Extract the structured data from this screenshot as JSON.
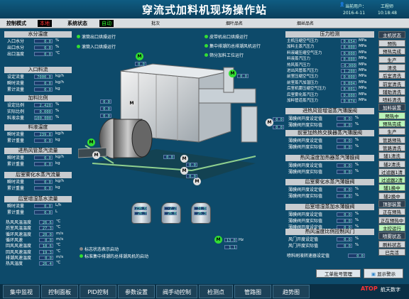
{
  "header": {
    "title": "穿流式加料机现场操作站",
    "user_label": "当前用户：",
    "user_value": "工程师",
    "date": "2016-4-11",
    "time": "10:18:48"
  },
  "statusbar": {
    "mode_label": "控制模式",
    "mode_value": "本地",
    "status_label": "系统状态",
    "status_value": "自动",
    "field1": "批次",
    "field2": "烟叶品名",
    "field3": "烟丝品名"
  },
  "left": {
    "water_title": "水分温度",
    "water_rows": [
      {
        "label": "入口水分",
        "value": "0.0",
        "unit": "%"
      },
      {
        "label": "出口水分",
        "value": "0.0",
        "unit": "%"
      },
      {
        "label": "出口温度",
        "value": "0.0",
        "unit": "℃"
      }
    ],
    "flow_title": "入口料流",
    "flow_rows": [
      {
        "label": "设定流量",
        "value": "7000.0",
        "unit": "kg/h"
      },
      {
        "label": "瞬时流量",
        "value": "0.0",
        "unit": "kg/h"
      },
      {
        "label": "累计流量",
        "value": "0.0",
        "unit": "kg"
      }
    ],
    "ratio_title": "加料比例",
    "ratio_rows": [
      {
        "label": "设定比例",
        "value": "2.420",
        "unit": "%"
      },
      {
        "label": "实际比例",
        "value": "0.000",
        "unit": "%"
      },
      {
        "label": "料液余量",
        "value": "100.000",
        "unit": "%"
      }
    ],
    "feedtemp_title": "料液温度",
    "feedtemp_rows": [
      {
        "label": "瞬时流量",
        "value": "239.8",
        "unit": "kg/h"
      },
      {
        "label": "累计重量",
        "value": "0.0",
        "unit": "kg"
      }
    ],
    "inlet_title": "进热风管蒸汽流量",
    "inlet_rows": [
      {
        "label": "瞬时流量",
        "value": "0.0",
        "unit": "kg/h"
      },
      {
        "label": "累计重量",
        "value": "0.0",
        "unit": "kg"
      }
    ],
    "spray_title": "后室雾化水蒸汽流量",
    "spray_rows": [
      {
        "label": "瞬时流量",
        "value": "0.0",
        "unit": "kg/h"
      },
      {
        "label": "累计重量",
        "value": "0.0",
        "unit": "kg"
      }
    ],
    "addwater_title": "后室增湿蒸水流量",
    "addwater_rows": [
      {
        "label": "瞬时流量",
        "value": "0.0",
        "unit": "L/h"
      },
      {
        "label": "累计重量",
        "value": "0.0",
        "unit": "L"
      }
    ],
    "misc_rows": [
      {
        "label": "热风风温温度",
        "value": "26.6",
        "unit": "℃"
      },
      {
        "label": "后室风温温度",
        "value": "27.3",
        "unit": "℃"
      },
      {
        "label": "循环风速温度",
        "value": "20.0",
        "unit": "m/s"
      },
      {
        "label": "循环风速",
        "value": "0.0",
        "unit": "m/s"
      },
      {
        "label": "回风风速温度",
        "value": "18.6",
        "unit": "℃"
      },
      {
        "label": "回风风速温度",
        "value": "19.3",
        "unit": "℃"
      },
      {
        "label": "排潮风速温度",
        "value": "0.0",
        "unit": "m/s"
      },
      {
        "label": "热风温度",
        "value": "26.4",
        "unit": "℃"
      }
    ]
  },
  "legend": {
    "top": [
      "滚筒出口烘燥运行",
      "滚筒入口烘燥运行"
    ],
    "top2": [
      "皮带机出口烘燥运行",
      "集中排潮的总排潮风机运行",
      "筛分加料工位运行"
    ],
    "bottom": [
      "标志状态表示启动",
      "标准集中排潮的总排潮风机的启动"
    ]
  },
  "center_values": {
    "m1": "0.0",
    "m1u": "Hz",
    "v_a": "0.0",
    "v_b": "0.0",
    "v_c": "0.0",
    "v_d": "0.0",
    "v_e": "0.0",
    "pump": "0.0",
    "pumpu": "Hz",
    "blower": "0.0",
    "v_f": "0.0",
    "v_g": "0.0",
    "fan_freq": "13.0",
    "fan_unit": "Hz",
    "fan_freq2": "1.1"
  },
  "tanks": [
    {
      "v1": "236.6",
      "v2": "26.7"
    },
    {
      "v1": "-2.2",
      "v2": "26.8"
    },
    {
      "v1": "31.8",
      "v2": "26.3"
    }
  ],
  "right": {
    "pressure_title": "压力检测",
    "pressure_rows": [
      {
        "label": "主机压缩空气压力",
        "value": "0.654",
        "unit": "MPa"
      },
      {
        "label": "加料主蒸汽压力",
        "value": "0.000",
        "unit": "MPa"
      },
      {
        "label": "料液罐压缩空气压力",
        "value": "0.000",
        "unit": "MPa"
      },
      {
        "label": "料液蒸汽压力",
        "value": "0.000",
        "unit": "MPa"
      },
      {
        "label": "热风蒸汽压力",
        "value": "-0.000",
        "unit": "MPa"
      },
      {
        "label": "进出风管蒸汽压力",
        "value": "1.200",
        "unit": "MPa"
      },
      {
        "label": "前室压缩空气压力",
        "value": "0.000",
        "unit": "MPa"
      },
      {
        "label": "前室蒸汽加湿压力",
        "value": "0.004",
        "unit": "MPa"
      },
      {
        "label": "后室机雾压缩空气压力",
        "value": "0.001",
        "unit": "MPa"
      },
      {
        "label": "后室雾化蒸汽压力",
        "value": "0.000",
        "unit": "MPa"
      },
      {
        "label": "加料管道蒸汽压力",
        "value": "0.074",
        "unit": "MPa"
      }
    ],
    "valve1_title": "进热风管增湿蒸汽薄膜阀",
    "valve2_title": "前室加热热交换器蒸汽薄膜阀",
    "valve3_title": "热风温度加热器蒸汽薄膜阀",
    "valve4_title": "后室雾化水蒸汽薄膜阀",
    "valve5_title": "后室增湿蒸加水薄膜阀",
    "valve_rows": [
      {
        "label": "薄膜阀开度设定值",
        "value": "0.0",
        "unit": "%"
      },
      {
        "label": "薄膜阀开度实际值",
        "value": "0.0",
        "unit": "%"
      }
    ],
    "valve5_rows": [
      {
        "label": "薄膜阀开度设定值",
        "value": "0.0",
        "unit": "%"
      },
      {
        "label": "薄膜阀开度实际值",
        "value": "0.0",
        "unit": "%"
      },
      {
        "label": "薄膜阀开度设定值",
        "value": "0.0",
        "unit": "%"
      }
    ],
    "hot_title": "热风温度比例控制风门",
    "hot_rows": [
      {
        "label": "风门开度设定值",
        "value": "0.0",
        "unit": "%"
      },
      {
        "label": "风门开度实际值",
        "value": "0.0",
        "unit": "%"
      }
    ],
    "spray_label": "喷料刷液转速器设定值",
    "spray_value": "0.0"
  },
  "sidebar": {
    "title": "主机状态",
    "items": [
      {
        "label": "预热",
        "style": "normal"
      },
      {
        "label": "预热完成",
        "style": "normal"
      },
      {
        "label": "生产",
        "style": "normal"
      },
      {
        "label": "清洗",
        "style": "normal"
      },
      {
        "label": "后室清洗",
        "style": "normal"
      },
      {
        "label": "前室清洗",
        "style": "normal"
      },
      {
        "label": "辅助清洗",
        "style": "normal"
      },
      {
        "label": "喷料清洗",
        "style": "normal"
      },
      {
        "label": "加料装置",
        "style": "dark"
      },
      {
        "label": "预热中",
        "style": "green"
      },
      {
        "label": "预热完成",
        "style": "green"
      },
      {
        "label": "生产",
        "style": "normal"
      },
      {
        "label": "管路预热",
        "style": "normal"
      },
      {
        "label": "管路清洗",
        "style": "normal"
      },
      {
        "label": "辅1清洗",
        "style": "normal"
      },
      {
        "label": "辅2清洗",
        "style": "normal"
      },
      {
        "label": "过滤器1清",
        "style": "normal"
      },
      {
        "label": "过滤器2清",
        "style": "green"
      },
      {
        "label": "辅1换中",
        "style": "green"
      },
      {
        "label": "辅2换中",
        "style": "normal"
      },
      {
        "label": "顶部装置",
        "style": "dark"
      },
      {
        "label": "正在预热",
        "style": "normal"
      },
      {
        "label": "正在预热中",
        "style": "normal"
      },
      {
        "label": "主控运行",
        "style": "green"
      },
      {
        "label": "喷雾状态",
        "style": "dark"
      },
      {
        "label": "刷料状态",
        "style": "normal"
      },
      {
        "label": "已完活",
        "style": "normal"
      }
    ]
  },
  "buttons": {
    "tune": "工单批号管理",
    "alarm": "显示警示"
  },
  "nav": [
    "集中监视",
    "控制面板",
    "PID控制",
    "参数设置",
    "阀手动控制",
    "检测点",
    "管路图",
    "趋势图"
  ],
  "brand": "航天数字",
  "colors": {
    "bg": "#0d4a6a",
    "value_text": "#7fffd4",
    "running": "#33dd33",
    "local": "#ff3333",
    "auto": "#33ff33"
  }
}
